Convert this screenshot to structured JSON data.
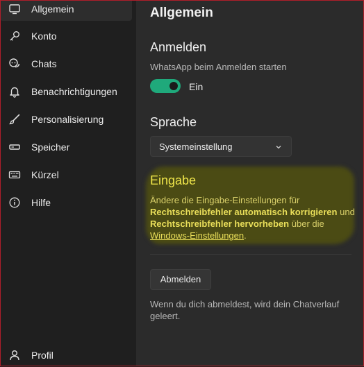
{
  "sidebar": {
    "items": [
      {
        "label": "Allgemein",
        "icon": "monitor-icon",
        "active": true
      },
      {
        "label": "Konto",
        "icon": "key-icon"
      },
      {
        "label": "Chats",
        "icon": "chat-bubbles-icon"
      },
      {
        "label": "Benachrichtigungen",
        "icon": "bell-icon"
      },
      {
        "label": "Personalisierung",
        "icon": "brush-icon"
      },
      {
        "label": "Speicher",
        "icon": "storage-icon"
      },
      {
        "label": "Kürzel",
        "icon": "keyboard-icon"
      },
      {
        "label": "Hilfe",
        "icon": "info-icon"
      }
    ],
    "profile": {
      "label": "Profil",
      "icon": "person-icon"
    }
  },
  "main": {
    "title": "Allgemein",
    "login": {
      "heading": "Anmelden",
      "description": "WhatsApp beim Anmelden starten",
      "toggle_state": "Ein",
      "toggle_on": true
    },
    "language": {
      "heading": "Sprache",
      "selected": "Systemeinstellung"
    },
    "input": {
      "heading": "Eingabe",
      "text_1": "Ändere die Eingabe-Einstellungen für",
      "bold_1": "Rechtschreibfehler automatisch korrigieren",
      "text_2": "und",
      "bold_2": "Rechtschreibfehler hervorheben",
      "text_3": "über die",
      "link": "Windows-Einstellungen",
      "text_4": "."
    },
    "logout": {
      "button": "Abmelden",
      "note": "Wenn du dich abmeldest, wird dein Chatverlauf geleert."
    }
  },
  "colors": {
    "accent": "#1fa97b",
    "highlight": "#4b4b14",
    "frame": "#b01e2a"
  }
}
